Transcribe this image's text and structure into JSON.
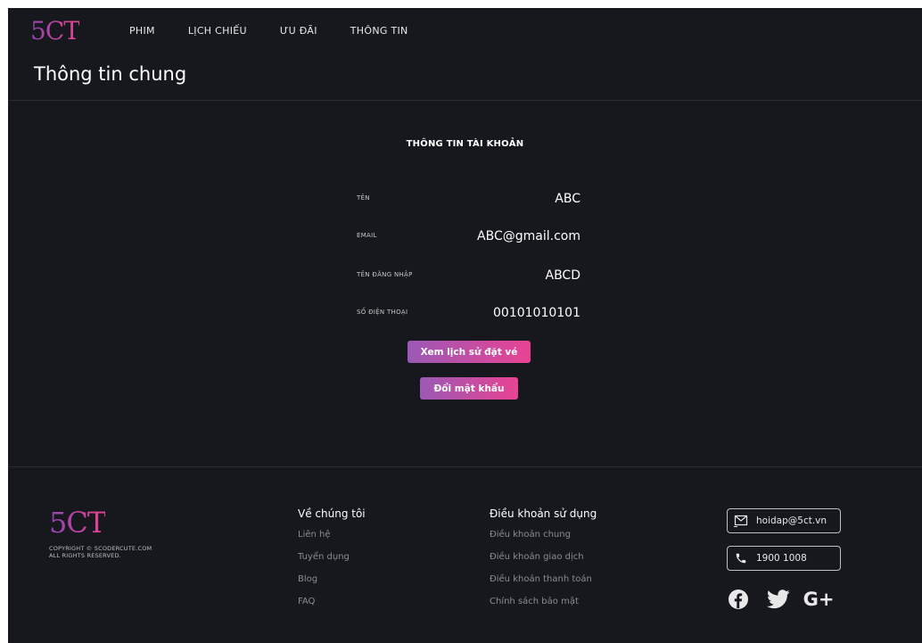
{
  "brand": {
    "logo_text": "5CT",
    "accent_start": "#8e44ad",
    "accent_end": "#e84393"
  },
  "nav": {
    "items": [
      "PHIM",
      "LỊCH CHIẾU",
      "ƯU ĐÃI",
      "THÔNG TIN"
    ]
  },
  "page": {
    "title": "Thông tin chung"
  },
  "account": {
    "section_title": "THÔNG TIN TÀI KHOẢN",
    "fields": [
      {
        "label": "TÊN",
        "value": "ABC"
      },
      {
        "label": "EMAIL",
        "value": "ABC@gmail.com"
      },
      {
        "label": "TÊN ĐĂNG NHẬP",
        "value": "ABCD"
      },
      {
        "label": "SỐ ĐIỆN THOẠI",
        "value": "00101010101"
      }
    ],
    "history_button": "Xem lịch sử đặt vé",
    "password_button": "Đổi mật khẩu"
  },
  "footer": {
    "logo_text": "5CT",
    "copyright_line1": "COPYRIGHT © SCODERCUTE.COM",
    "copyright_line2": "ALL RIGHTS RESERVED.",
    "about": {
      "title": "Về chúng tôi",
      "links": [
        "Liên hệ",
        "Tuyển dụng",
        "Blog",
        "FAQ"
      ]
    },
    "terms": {
      "title": "Điều khoản sử dụng",
      "links": [
        "Điều khoản chung",
        "Điều khoản giao dịch",
        "Điều khoản thanh toán",
        "Chính sách bảo mật"
      ]
    },
    "contact": {
      "email": "hoidap@5ct.vn",
      "phone": "1900 1008"
    },
    "socials": [
      "facebook-icon",
      "twitter-icon",
      "google-plus-icon"
    ],
    "google_plus_glyph": "G+"
  }
}
